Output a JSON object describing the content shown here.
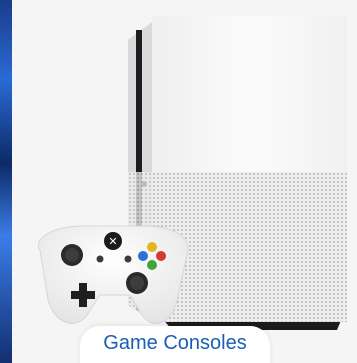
{
  "category_card": {
    "caption": "Game Consoles",
    "caption_color": "#1a5fb4",
    "image_subject": "console-with-controller"
  },
  "colors": {
    "console_white": "#f7f7f8",
    "controller_white": "#fbfbfc",
    "stand_black": "#1b1b1c",
    "button_a": "#41a53a",
    "button_b": "#d43a2f",
    "button_x": "#2c6fd6",
    "button_y": "#e6b51e"
  }
}
